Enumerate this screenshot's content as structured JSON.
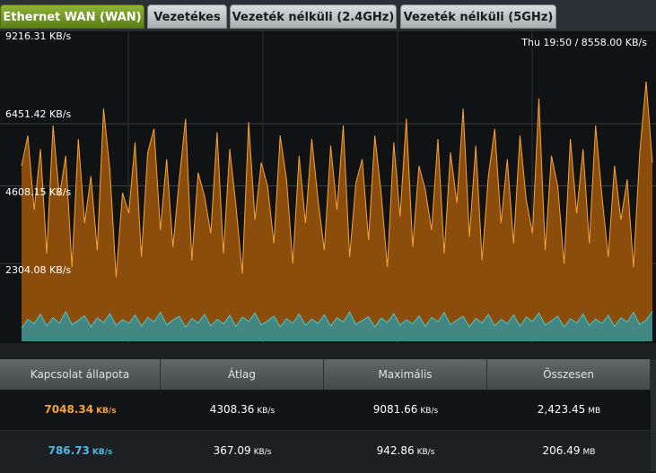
{
  "tabs": [
    {
      "label": "Ethernet WAN (WAN)",
      "active": true
    },
    {
      "label": "Vezetékes",
      "active": false
    },
    {
      "label": "Vezeték nélküli (2.4GHz)",
      "active": false
    },
    {
      "label": "Vezeték nélküli (5GHz)",
      "active": false
    }
  ],
  "chart": {
    "status": "Thu 19:50 / 8558.00 KB/s",
    "y_labels": [
      "9216.31 KB/s",
      "6451.42 KB/s",
      "4608.15 KB/s",
      "2304.08 KB/s"
    ]
  },
  "chart_data": {
    "type": "area",
    "ylim": [
      0,
      9216.31
    ],
    "yticks": [
      9216.31,
      6451.42,
      4608.15,
      2304.08
    ],
    "grid": true,
    "colors": {
      "receive": "#f5a43e",
      "transmit": "#5bc0be"
    },
    "series": [
      {
        "values": [
          5200,
          6100,
          3900,
          5700,
          2600,
          6400,
          4300,
          5500,
          2200,
          6000,
          3500,
          4900,
          2700,
          6900,
          5100,
          1900,
          4400,
          3800,
          5900,
          2500,
          5600,
          6300,
          3300,
          5400,
          2800,
          4800,
          6600,
          2400,
          5000,
          4300,
          3200,
          6200,
          2600,
          5700,
          4000,
          2000,
          6500,
          3600,
          5300,
          4600,
          2900,
          6100,
          4800,
          2300,
          5500,
          3500,
          6000,
          4200,
          2700,
          5800,
          3900,
          6400,
          2500,
          4700,
          5400,
          3000,
          6100,
          4400,
          2200,
          5900,
          3700,
          6600,
          2800,
          5200,
          4500,
          3300,
          6000,
          2600,
          5600,
          4100,
          6900,
          3100,
          5800,
          2400,
          4900,
          6300,
          3500,
          5400,
          2900,
          6100,
          4200,
          3200,
          7200,
          2700,
          5500,
          4600,
          2300,
          6000,
          3800,
          5700,
          2900,
          6400,
          4300,
          2500,
          5200,
          3600,
          4800,
          2200,
          5600,
          7700,
          5300
        ]
      },
      {
        "values": [
          400,
          650,
          520,
          800,
          460,
          700,
          540,
          880,
          500,
          620,
          760,
          430,
          690,
          560,
          820,
          470,
          640,
          530,
          780,
          450,
          710,
          580,
          860,
          490,
          630,
          740,
          420,
          680,
          550,
          800,
          460,
          650,
          520,
          770,
          440,
          720,
          590,
          840,
          480,
          610,
          750,
          430,
          670,
          540,
          810,
          470,
          660,
          530,
          790,
          450,
          700,
          570,
          870,
          500,
          620,
          730,
          420,
          690,
          560,
          820,
          480,
          640,
          510,
          760,
          440,
          710,
          580,
          850,
          490,
          630,
          740,
          430,
          680,
          550,
          800,
          460,
          650,
          520,
          780,
          450,
          720,
          590,
          840,
          480,
          610,
          750,
          420,
          670,
          540,
          810,
          470,
          660,
          530,
          770,
          440,
          700,
          570,
          860,
          500,
          630,
          887
        ]
      }
    ]
  },
  "stats": {
    "headers": [
      "Kapcsolat állapota",
      "Átlag",
      "Maximális",
      "Összesen"
    ],
    "rows": [
      {
        "current": "7048.34",
        "current_unit": "KB/s",
        "average": "4308.36",
        "average_unit": "KB/s",
        "max": "9081.66",
        "max_unit": "KB/s",
        "total": "2,423.45",
        "total_unit": "MB"
      },
      {
        "current": "786.73",
        "current_unit": "KB/s",
        "average": "367.09",
        "average_unit": "KB/s",
        "max": "942.86",
        "max_unit": "KB/s",
        "total": "206.49",
        "total_unit": "MB"
      }
    ]
  }
}
